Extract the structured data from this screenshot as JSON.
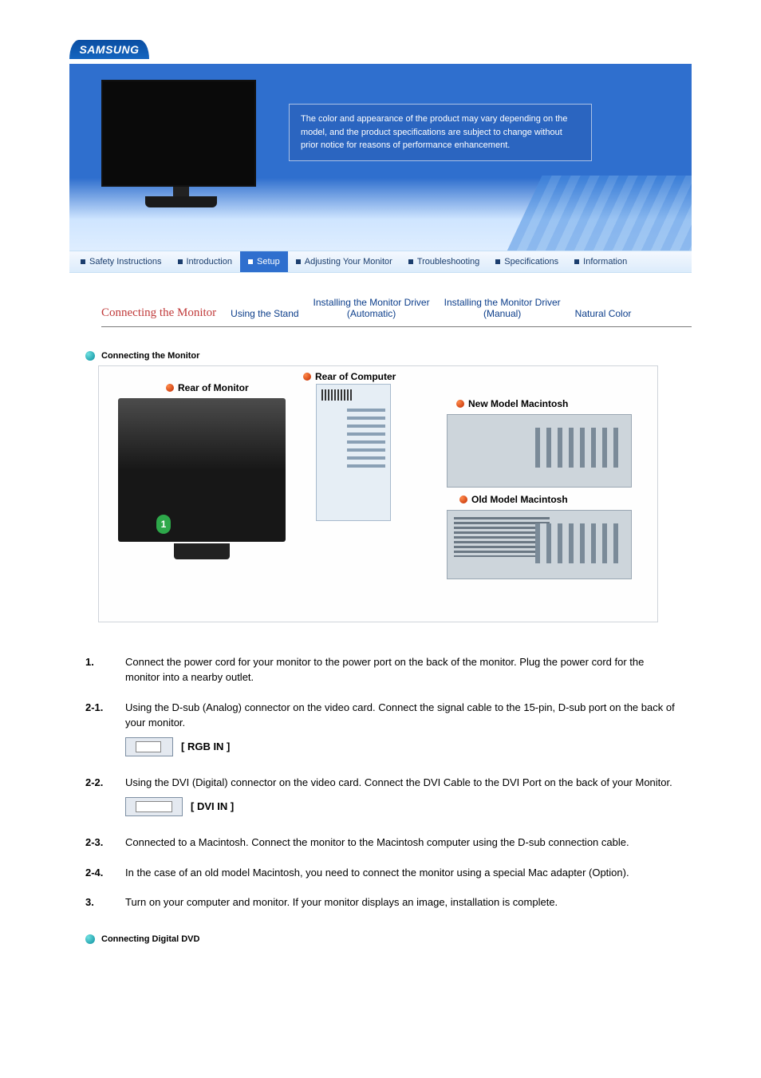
{
  "brand": "SAMSUNG",
  "hero": {
    "notice": "The color and appearance of the product may vary depending on the model, and the product specifications are subject to change without prior notice for reasons of performance enhancement."
  },
  "nav": {
    "items": [
      "Safety Instructions",
      "Introduction",
      "Setup",
      "Adjusting Your Monitor",
      "Troubleshooting",
      "Specifications",
      "Information"
    ],
    "activeIndex": 2
  },
  "subtabs": {
    "items": [
      "Connecting the Monitor",
      "Using the Stand",
      "Installing the Monitor Driver\n(Automatic)",
      "Installing the Monitor Driver\n(Manual)",
      "Natural Color"
    ],
    "activeIndex": 0
  },
  "sections": {
    "connecting_monitor": "Connecting the Monitor",
    "connecting_dvd": "Connecting Digital DVD"
  },
  "diagram": {
    "rear_monitor": "Rear of Monitor",
    "rear_computer": "Rear of Computer",
    "new_mac": "New Model Macintosh",
    "old_mac": "Old Model Macintosh",
    "badge": "1"
  },
  "steps": [
    {
      "num": "1.",
      "text": "Connect the power cord for your monitor to the power port on the back of the monitor. Plug the power cord for the monitor into a nearby outlet."
    },
    {
      "num": "2-1.",
      "text": "Using the D-sub (Analog) connector on the video card. Connect the signal cable to the 15-pin, D-sub port on the back of your monitor.",
      "port": "rgb"
    },
    {
      "num": "2-2.",
      "text": "Using the DVI (Digital) connector on the video card. Connect the DVI Cable to the DVI Port on the back of your Monitor.",
      "port": "dvi"
    },
    {
      "num": "2-3.",
      "text": "Connected to a Macintosh. Connect the monitor to the Macintosh computer using the D-sub connection cable."
    },
    {
      "num": "2-4.",
      "text": "In the case of an old model Macintosh, you need to connect the monitor using a special Mac adapter (Option)."
    },
    {
      "num": "3.",
      "text": "Turn on your computer and monitor. If your monitor displays an image, installation is complete."
    }
  ],
  "port_labels": {
    "rgb": "[ RGB IN ]",
    "dvi": "[ DVI IN ]"
  }
}
